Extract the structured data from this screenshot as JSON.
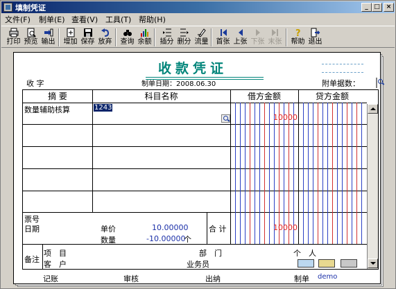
{
  "window": {
    "title": "填制凭证"
  },
  "menu": [
    {
      "label": "文件(F)"
    },
    {
      "label": "制单(E)"
    },
    {
      "label": "查看(V)"
    },
    {
      "label": "工具(T)"
    },
    {
      "label": "帮助(H)"
    }
  ],
  "toolbar": [
    {
      "label": "打印",
      "icon": "print-icon"
    },
    {
      "label": "预览",
      "icon": "preview-icon"
    },
    {
      "label": "输出",
      "icon": "export-icon"
    },
    {
      "label": "增加",
      "icon": "add-icon"
    },
    {
      "label": "保存",
      "icon": "save-icon"
    },
    {
      "label": "放弃",
      "icon": "undo-icon"
    },
    {
      "label": "查询",
      "icon": "binoculars-icon"
    },
    {
      "label": "余额",
      "icon": "balance-chart-icon"
    },
    {
      "label": "插分",
      "icon": "insert-row-icon"
    },
    {
      "label": "删分",
      "icon": "delete-row-icon"
    },
    {
      "label": "流量",
      "icon": "cashflow-icon"
    },
    {
      "label": "首张",
      "icon": "first-icon"
    },
    {
      "label": "上张",
      "icon": "prev-icon"
    },
    {
      "label": "下张",
      "icon": "next-icon"
    },
    {
      "label": "末张",
      "icon": "last-icon"
    },
    {
      "label": "帮助",
      "icon": "help-icon"
    },
    {
      "label": "退出",
      "icon": "exit-icon"
    }
  ],
  "voucher": {
    "title": "收款凭证",
    "type_label": "收 字",
    "date_label": "制单日期：2008.06.30",
    "attachments_label": "附单据数：",
    "headers": {
      "summary": "摘 要",
      "account": "科目名称",
      "debit": "借方金额",
      "credit": "贷方金额"
    },
    "rows": [
      {
        "summary": "数量辅助核算",
        "account": "1243",
        "debit": "10000",
        "credit": ""
      }
    ],
    "bottom": {
      "ticket_no": "票号",
      "date": "日期",
      "unit_price_label": "单价",
      "unit_price": "10.00000",
      "quantity_label": "数量",
      "quantity": "-10.00000",
      "quantity_unit": "个",
      "total_label": "合 计",
      "total_debit": "10000"
    },
    "notes": {
      "label": "备注",
      "project": "项　目",
      "customer": "客　户",
      "department": "部　门",
      "person": "个　人",
      "salesman": "业务员"
    },
    "footer": {
      "bookkeeping": "记账",
      "audit": "审核",
      "cashier": "出纳",
      "maker_label": "制单",
      "maker": "demo"
    }
  }
}
